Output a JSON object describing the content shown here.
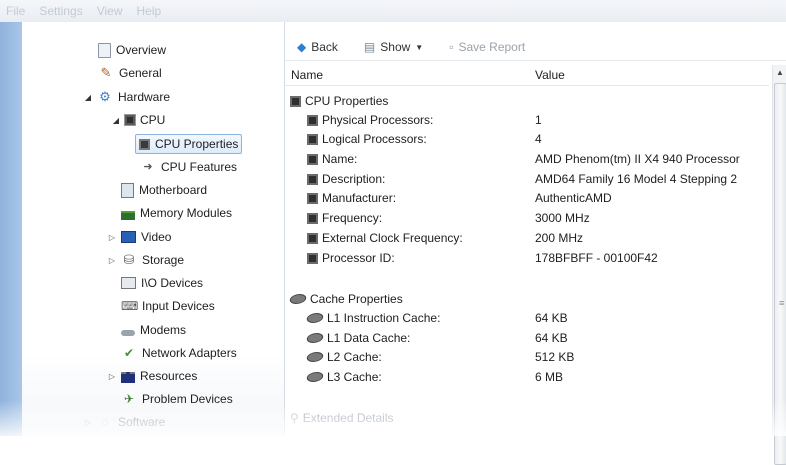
{
  "menubar": [
    "File",
    "Settings",
    "View",
    "Help"
  ],
  "tree": [
    {
      "label": "Overview",
      "icon": "document-icon",
      "level": 0
    },
    {
      "label": "General",
      "icon": "gear-icon",
      "level": 0
    },
    {
      "label": "Hardware",
      "icon": "hardware-icon",
      "level": 0
    },
    {
      "label": "CPU",
      "icon": "chip-icon",
      "level": 1
    },
    {
      "label": "CPU Properties",
      "icon": "chip-icon",
      "level": 2,
      "selected": true
    },
    {
      "label": "CPU Features",
      "icon": "arrow-icon",
      "level": 2
    },
    {
      "label": "Motherboard",
      "icon": "motherboard-icon",
      "level": 1
    },
    {
      "label": "Memory Modules",
      "icon": "memory-icon",
      "level": 1
    },
    {
      "label": "Video",
      "icon": "video-icon",
      "level": 1
    },
    {
      "label": "Storage",
      "icon": "storage-icon",
      "level": 1
    },
    {
      "label": "I\\O Devices",
      "icon": "io-devices-icon",
      "level": 1
    },
    {
      "label": "Input Devices",
      "icon": "input-devices-icon",
      "level": 1
    },
    {
      "label": "Modems",
      "icon": "modem-icon",
      "level": 1
    },
    {
      "label": "Network Adapters",
      "icon": "network-icon",
      "level": 1
    },
    {
      "label": "Resources",
      "icon": "resources-icon",
      "level": 1
    },
    {
      "label": "Problem Devices",
      "icon": "problem-devices-icon",
      "level": 1
    },
    {
      "label": "Software",
      "icon": "software-icon",
      "level": 0
    }
  ],
  "toolbar": {
    "back": "Back",
    "show": "Show",
    "save": "Save Report"
  },
  "columns": {
    "name": "Name",
    "value": "Value"
  },
  "cpu_section": "CPU Properties",
  "cpu_props": [
    {
      "name": "Physical Processors:",
      "value": "1"
    },
    {
      "name": "Logical Processors:",
      "value": "4"
    },
    {
      "name": "Name:",
      "value": "AMD Phenom(tm) II X4 940 Processor"
    },
    {
      "name": "Description:",
      "value": "AMD64 Family 16 Model 4 Stepping 2"
    },
    {
      "name": "Manufacturer:",
      "value": "AuthenticAMD"
    },
    {
      "name": "Frequency:",
      "value": "3000 MHz"
    },
    {
      "name": "External Clock Frequency:",
      "value": "200 MHz"
    },
    {
      "name": "Processor ID:",
      "value": "178BFBFF - 00100F42"
    }
  ],
  "cache_section": "Cache Properties",
  "cache_props": [
    {
      "name": "L1 Instruction Cache:",
      "value": "64 KB"
    },
    {
      "name": "L1 Data Cache:",
      "value": "64 KB"
    },
    {
      "name": "L2 Cache:",
      "value": "512 KB"
    },
    {
      "name": "L3 Cache:",
      "value": "6 MB"
    }
  ],
  "extended_section": "Extended Details"
}
